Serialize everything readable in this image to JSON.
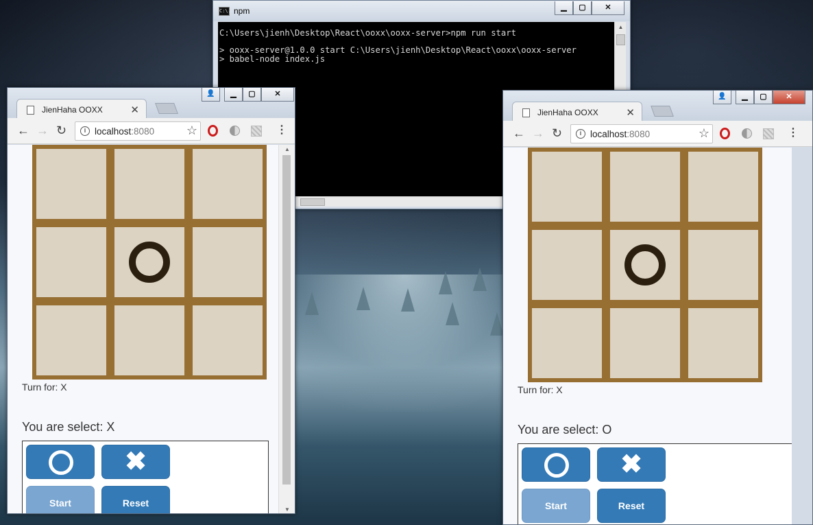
{
  "cmd": {
    "icon_text": "C:\\.",
    "title": "npm",
    "lines": [
      "C:\\Users\\jienh\\Desktop\\React\\ooxx\\ooxx-server>npm run start",
      "",
      "> ooxx-server@1.0.0 start C:\\Users\\jienh\\Desktop\\React\\ooxx\\ooxx-server",
      "> babel-node index.js"
    ],
    "minimize_icon": "minimize-icon",
    "maximize_icon": "maximize-icon",
    "close_icon": "close-icon"
  },
  "browser_left": {
    "tab_title": "JienHaha OOXX",
    "tab_close": "✕",
    "url_host": "localhost",
    "url_port": ":8080",
    "board": [
      "",
      "",
      "",
      "",
      "O",
      "",
      "",
      "",
      ""
    ],
    "turn_text": "Turn for: X",
    "select_text": "You are select: X",
    "buttons": {
      "start": "Start",
      "reset": "Reset"
    }
  },
  "browser_right": {
    "tab_title": "JienHaha OOXX",
    "tab_close": "✕",
    "url_host": "localhost",
    "url_port": ":8080",
    "board": [
      "",
      "",
      "",
      "",
      "O",
      "",
      "",
      "",
      ""
    ],
    "turn_text": "Turn for: X",
    "select_text": "You are select: O",
    "buttons": {
      "start": "Start",
      "reset": "Reset"
    }
  },
  "icons": {
    "back": "←",
    "forward": "→",
    "reload": "↻",
    "star": "☆",
    "menu": "⋮",
    "x_mark": "✖",
    "info": "i"
  },
  "colors": {
    "board_frame": "#976f33",
    "cell": "#ddd3c3",
    "o_mark": "#2b2010",
    "button_primary": "#337ab7",
    "button_disabled": "#7aa6d1"
  }
}
